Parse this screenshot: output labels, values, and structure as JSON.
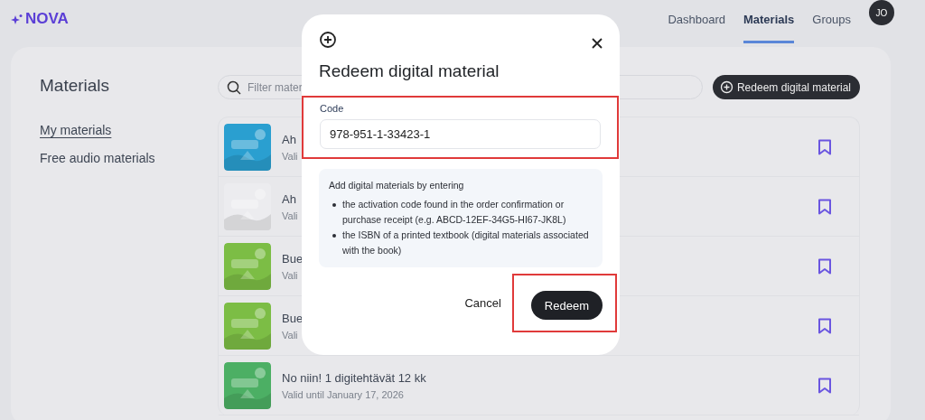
{
  "header": {
    "logo": "NOVA",
    "nav": [
      {
        "label": "Dashboard",
        "selected": false
      },
      {
        "label": "Materials",
        "selected": true
      },
      {
        "label": "Groups",
        "selected": false
      }
    ],
    "avatar": "JO"
  },
  "sidebar": {
    "title": "Materials",
    "items": [
      {
        "label": "My materials",
        "selected": true
      },
      {
        "label": "Free audio materials",
        "selected": false
      }
    ]
  },
  "search": {
    "placeholder": "Filter mater"
  },
  "redeem_button": "Redeem digital material",
  "materials": [
    {
      "title": "Ah",
      "subtitle": "Vali"
    },
    {
      "title": "Ah",
      "subtitle": "Vali"
    },
    {
      "title": "Bue",
      "subtitle": "Vali"
    },
    {
      "title": "Bue",
      "subtitle": "Vali"
    },
    {
      "title": "No niin! 1 digitehtävät 12 kk",
      "subtitle": "Valid until January 17, 2026"
    }
  ],
  "dialog": {
    "title": "Redeem digital material",
    "code_label": "Code",
    "code_value": "978-951-1-33423-1",
    "code_highlighted": true,
    "info_intro": "Add digital materials by entering",
    "info_items": [
      "the activation code found in the order confirmation or purchase receipt (e.g. ABCD-12EF-34G5-HI67-JK8L)",
      "the ISBN of a printed textbook (digital materials associated with the book)"
    ],
    "cancel": "Cancel",
    "submit": "Redeem",
    "submit_highlighted": true
  }
}
